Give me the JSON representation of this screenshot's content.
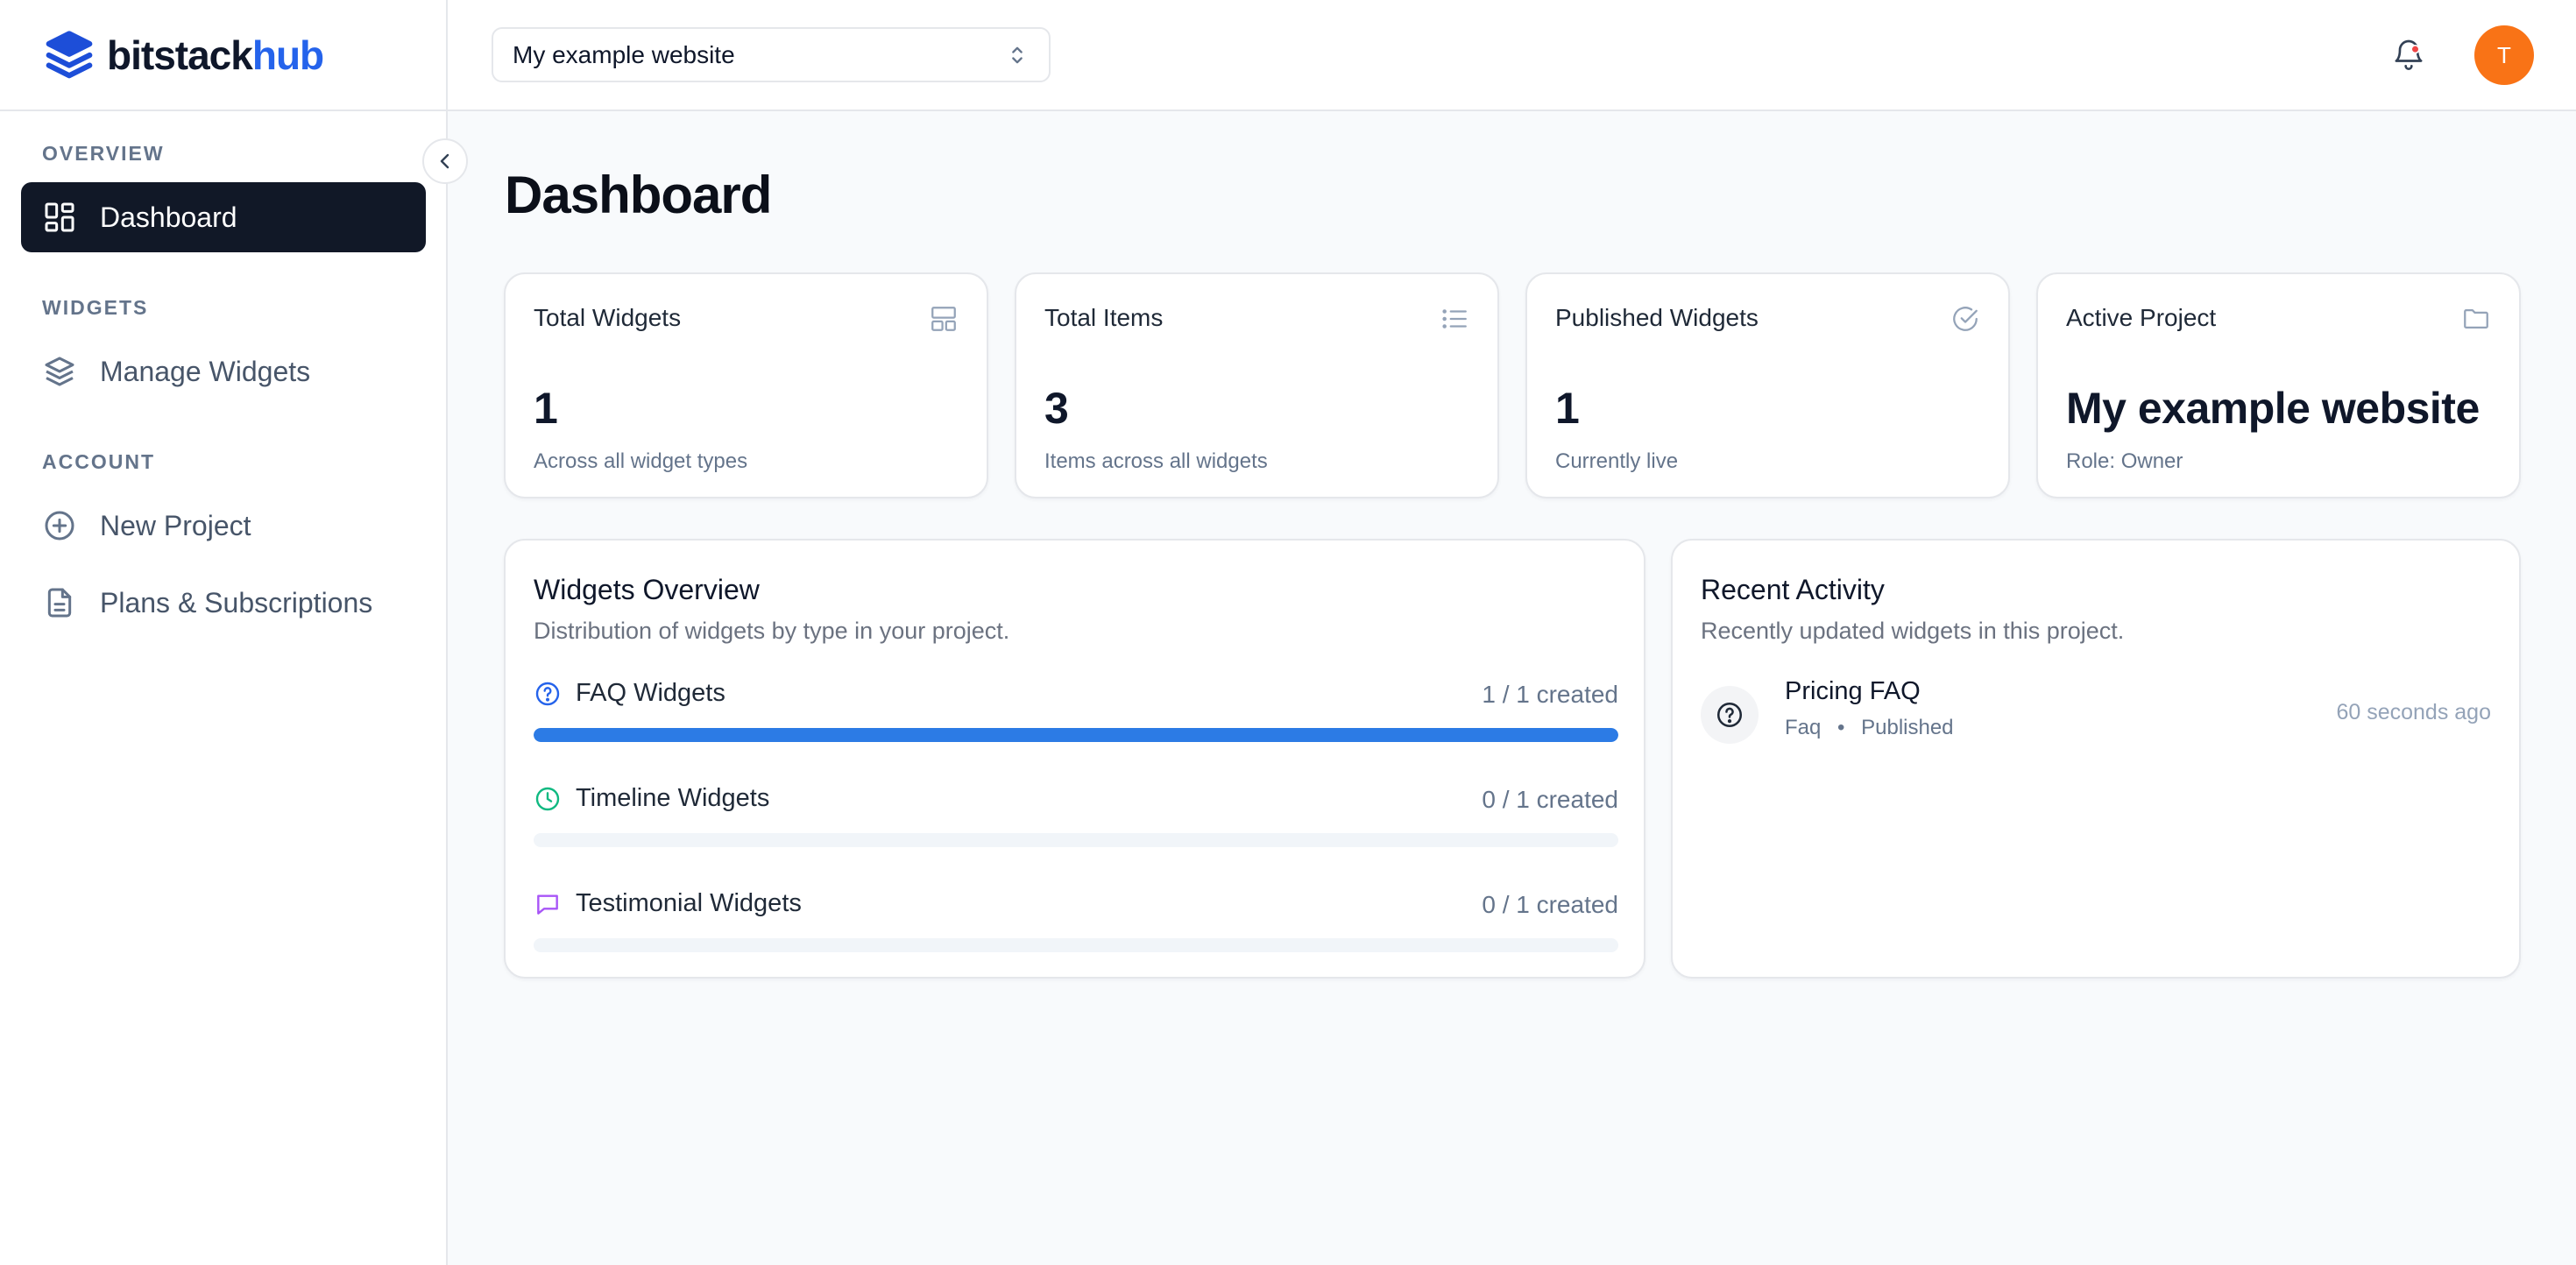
{
  "brand": {
    "name_part1": "bitstack",
    "name_part2": "hub"
  },
  "sidebar": {
    "sections": [
      {
        "label": "OVERVIEW",
        "items": [
          {
            "label": "Dashboard",
            "icon": "grid-icon",
            "active": true
          }
        ]
      },
      {
        "label": "WIDGETS",
        "items": [
          {
            "label": "Manage Widgets",
            "icon": "layers-icon"
          }
        ]
      },
      {
        "label": "ACCOUNT",
        "items": [
          {
            "label": "New Project",
            "icon": "plus-circle-icon"
          },
          {
            "label": "Plans & Subscriptions",
            "icon": "document-icon"
          }
        ]
      }
    ]
  },
  "topbar": {
    "project_select": "My example website",
    "avatar_initial": "T",
    "notification_dot_color": "#ef4444"
  },
  "page": {
    "title": "Dashboard"
  },
  "stats": [
    {
      "title": "Total Widgets",
      "value": "1",
      "sub": "Across all widget types",
      "icon": "layout-icon"
    },
    {
      "title": "Total Items",
      "value": "3",
      "sub": "Items across all widgets",
      "icon": "list-icon"
    },
    {
      "title": "Published Widgets",
      "value": "1",
      "sub": "Currently live",
      "icon": "check-circle-icon"
    },
    {
      "title": "Active Project",
      "value": "My example website",
      "sub": "Role: Owner",
      "icon": "folder-icon"
    }
  ],
  "overview": {
    "title": "Widgets Overview",
    "subtitle": "Distribution of widgets by type in your project.",
    "rows": [
      {
        "label": "FAQ Widgets",
        "count": "1 / 1 created",
        "progress": 1.0,
        "icon": "question-circle-icon",
        "icon_color": "#2563eb"
      },
      {
        "label": "Timeline Widgets",
        "count": "0 / 1 created",
        "progress": 0.0,
        "icon": "clock-icon",
        "icon_color": "#10b981"
      },
      {
        "label": "Testimonial Widgets",
        "count": "0 / 1 created",
        "progress": 0.0,
        "icon": "message-square-icon",
        "icon_color": "#a855f7"
      }
    ]
  },
  "activity": {
    "title": "Recent Activity",
    "subtitle": "Recently updated widgets in this project.",
    "items": [
      {
        "title": "Pricing FAQ",
        "type": "Faq",
        "separator": "•",
        "status": "Published",
        "time": "60 seconds ago",
        "icon": "question-circle-icon"
      }
    ]
  },
  "colors": {
    "accent": "#2563eb",
    "progress": "#2c7be5",
    "active_nav": "#111827",
    "avatar": "#f97316"
  }
}
